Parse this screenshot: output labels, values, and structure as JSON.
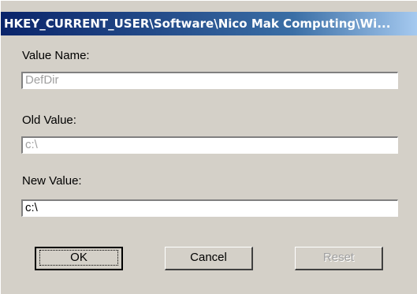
{
  "window": {
    "title": "HKEY_CURRENT_USER\\Software\\Nico Mak Computing\\Wi..."
  },
  "value_name": {
    "label": "Value Name:",
    "value": "DefDir"
  },
  "old_value": {
    "label": "Old Value:",
    "value": "c:\\"
  },
  "new_value": {
    "label": "New Value:",
    "value": "c:\\"
  },
  "buttons": {
    "ok": "OK",
    "cancel": "Cancel",
    "reset": "Reset"
  }
}
